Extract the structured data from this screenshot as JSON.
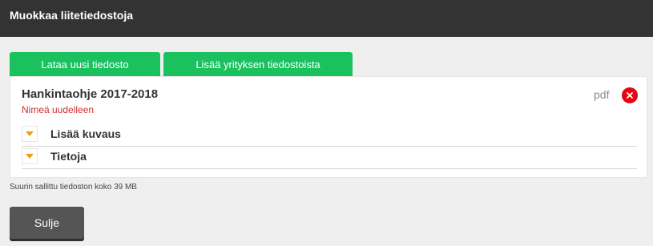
{
  "dialog": {
    "title": "Muokkaa liitetiedostoja"
  },
  "actions": {
    "upload_label": "Lataa uusi tiedosto",
    "company_files_label": "Lisää yrityksen tiedostoista"
  },
  "file": {
    "name": "Hankintaohje 2017-2018",
    "rename_label": "Nimeä uudelleen",
    "type": "pdf",
    "remove_icon": "close-icon",
    "sections": [
      {
        "label": "Lisää kuvaus",
        "icon": "chevron-down-icon"
      },
      {
        "label": "Tietoja",
        "icon": "chevron-down-icon"
      }
    ]
  },
  "footer": {
    "max_size_text": "Suurin sallittu tiedoston koko 39 MB",
    "close_label": "Sulje"
  },
  "colors": {
    "header_bg": "#333333",
    "accent_green": "#1bc15f",
    "danger_red": "#e30613",
    "link_red": "#d32f2f",
    "caret_orange": "#f39c12",
    "close_button_bg": "#555555"
  }
}
